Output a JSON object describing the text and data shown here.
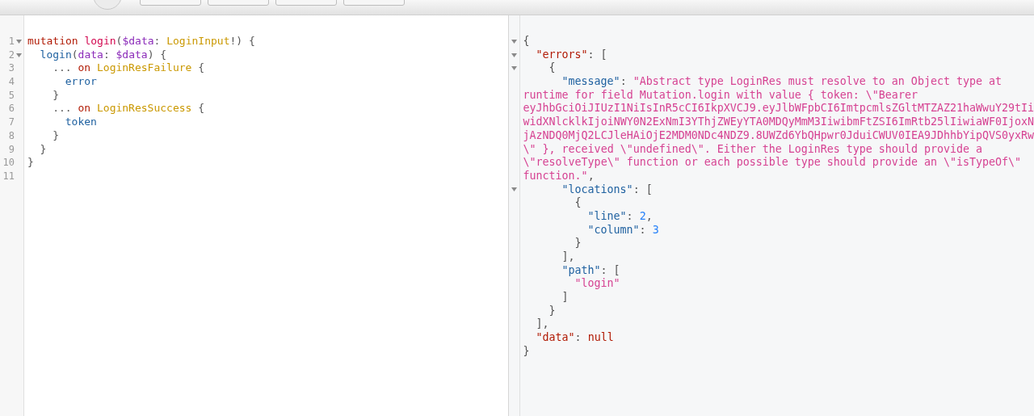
{
  "toolbar": {
    "buttons": [
      {
        "kind": "round"
      },
      {
        "kind": "rect"
      },
      {
        "kind": "rect"
      },
      {
        "kind": "rect"
      },
      {
        "kind": "rect"
      }
    ]
  },
  "editor": {
    "lines": [
      {
        "number": "1",
        "fold": true,
        "tokens": [
          {
            "kind": "keyword",
            "text": "mutation "
          },
          {
            "kind": "def",
            "text": "login"
          },
          {
            "kind": "punct",
            "text": "("
          },
          {
            "kind": "variable",
            "text": "$data"
          },
          {
            "kind": "punct",
            "text": ": "
          },
          {
            "kind": "type",
            "text": "LoginInput"
          },
          {
            "kind": "punct",
            "text": "!) {"
          }
        ]
      },
      {
        "number": "2",
        "fold": true,
        "tokens": [
          {
            "kind": "property",
            "text": "login"
          },
          {
            "kind": "punct",
            "text": "("
          },
          {
            "kind": "attribute",
            "text": "data"
          },
          {
            "kind": "punct",
            "text": ": "
          },
          {
            "kind": "variable",
            "text": "$data"
          },
          {
            "kind": "punct",
            "text": ") {"
          }
        ]
      },
      {
        "number": "3",
        "fold": false,
        "tokens": [
          {
            "kind": "punct",
            "text": "... "
          },
          {
            "kind": "keyword",
            "text": "on "
          },
          {
            "kind": "type",
            "text": "LoginResFailure"
          },
          {
            "kind": "punct",
            "text": " {"
          }
        ]
      },
      {
        "number": "4",
        "fold": false,
        "tokens": [
          {
            "kind": "property",
            "text": "error"
          }
        ]
      },
      {
        "number": "5",
        "fold": false,
        "tokens": [
          {
            "kind": "punct",
            "text": "}"
          }
        ]
      },
      {
        "number": "6",
        "fold": false,
        "tokens": [
          {
            "kind": "punct",
            "text": "... "
          },
          {
            "kind": "keyword",
            "text": "on "
          },
          {
            "kind": "type",
            "text": "LoginResSuccess"
          },
          {
            "kind": "punct",
            "text": " {"
          }
        ]
      },
      {
        "number": "7",
        "fold": false,
        "tokens": [
          {
            "kind": "property",
            "text": "token"
          }
        ]
      },
      {
        "number": "8",
        "fold": false,
        "tokens": [
          {
            "kind": "punct",
            "text": "}"
          }
        ]
      },
      {
        "number": "9",
        "fold": false,
        "tokens": [
          {
            "kind": "punct",
            "text": "}"
          }
        ]
      },
      {
        "number": "10",
        "fold": false,
        "tokens": [
          {
            "kind": "punct",
            "text": "}"
          }
        ]
      },
      {
        "number": "11",
        "fold": false
      }
    ]
  },
  "result": {
    "lines": [
      {
        "fold": true,
        "kind": "code",
        "tokens": [
          {
            "kind": "punct",
            "text": "{"
          }
        ]
      },
      {
        "fold": true,
        "kind": "code",
        "tokens": [
          {
            "kind": "keyred",
            "text": "\"errors\""
          },
          {
            "kind": "punct",
            "text": ": ["
          }
        ]
      },
      {
        "fold": true,
        "kind": "code",
        "tokens": [
          {
            "kind": "punct",
            "text": "{"
          }
        ]
      },
      {
        "fold": false,
        "kind": "code",
        "tokens": [
          {
            "kind": "key",
            "text": "\"message\""
          },
          {
            "kind": "punct",
            "text": ": "
          },
          {
            "kind": "string",
            "text": "\"Abstract type LoginRes must resolve to an Object type at"
          }
        ]
      },
      {
        "fold": false,
        "kind": "wrap",
        "tokens": [
          {
            "kind": "string",
            "text": "runtime for field Mutation.login with value { token: \\\"Bearer"
          }
        ]
      },
      {
        "fold": false,
        "kind": "wrap",
        "tokens": [
          {
            "kind": "string",
            "text": "eyJhbGciOiJIUzI1NiIsInR5cCI6IkpXVCJ9.eyJlbWFpbCI6ImtpcmlsZGltMTZAZ21haWwuY29tIi"
          }
        ]
      },
      {
        "fold": false,
        "kind": "wrap",
        "tokens": [
          {
            "kind": "string",
            "text": "widXNlcklkIjoiNWY0N2ExNmI3YThjZWEyYTA0MDQyMmM3IiwibmFtZSI6ImRtb25lIiwiaWF0IjoxN"
          }
        ]
      },
      {
        "fold": false,
        "kind": "wrap",
        "tokens": [
          {
            "kind": "string",
            "text": "jAzNDQ0MjQ2LCJleHAiOjE2MDM0NDc4NDZ9.8UWZd6YbQHpwr0JduiCWUV0IEA9JDhhbYipQVS0yxRw"
          }
        ]
      },
      {
        "fold": false,
        "kind": "wrap",
        "tokens": [
          {
            "kind": "string",
            "text": "\\\" }, received \\\"undefined\\\". Either the LoginRes type should provide a"
          }
        ]
      },
      {
        "fold": false,
        "kind": "wrap",
        "tokens": [
          {
            "kind": "string",
            "text": "\\\"resolveType\\\" function or each possible type should provide an \\\"isTypeOf\\\""
          }
        ]
      },
      {
        "fold": false,
        "kind": "wrap",
        "tokens": [
          {
            "kind": "string",
            "text": "function.\""
          },
          {
            "kind": "punct",
            "text": ","
          }
        ]
      },
      {
        "fold": true,
        "kind": "code",
        "tokens": [
          {
            "kind": "key",
            "text": "\"locations\""
          },
          {
            "kind": "punct",
            "text": ": ["
          }
        ]
      },
      {
        "fold": false,
        "kind": "code",
        "tokens": [
          {
            "kind": "punct",
            "text": "{"
          }
        ]
      },
      {
        "fold": false,
        "kind": "code",
        "tokens": [
          {
            "kind": "key",
            "text": "\"line\""
          },
          {
            "kind": "punct",
            "text": ": "
          },
          {
            "kind": "number",
            "text": "2"
          },
          {
            "kind": "punct",
            "text": ","
          }
        ]
      },
      {
        "fold": false,
        "kind": "code",
        "tokens": [
          {
            "kind": "key",
            "text": "\"column\""
          },
          {
            "kind": "punct",
            "text": ": "
          },
          {
            "kind": "number",
            "text": "3"
          }
        ]
      },
      {
        "fold": false,
        "kind": "code",
        "tokens": [
          {
            "kind": "punct",
            "text": "}"
          }
        ]
      },
      {
        "fold": false,
        "kind": "code",
        "tokens": [
          {
            "kind": "punct",
            "text": "],"
          }
        ]
      },
      {
        "fold": false,
        "kind": "code",
        "tokens": [
          {
            "kind": "key",
            "text": "\"path\""
          },
          {
            "kind": "punct",
            "text": ": ["
          }
        ]
      },
      {
        "fold": false,
        "kind": "code",
        "tokens": [
          {
            "kind": "string",
            "text": "\"login\""
          }
        ]
      },
      {
        "fold": false,
        "kind": "code",
        "tokens": [
          {
            "kind": "punct",
            "text": "]"
          }
        ]
      },
      {
        "fold": false,
        "kind": "code",
        "tokens": [
          {
            "kind": "punct",
            "text": "}"
          }
        ]
      },
      {
        "fold": false,
        "kind": "code",
        "tokens": [
          {
            "kind": "punct",
            "text": "],"
          }
        ]
      },
      {
        "fold": false,
        "kind": "code",
        "tokens": [
          {
            "kind": "keyred",
            "text": "\"data\""
          },
          {
            "kind": "punct",
            "text": ": "
          },
          {
            "kind": "nullv",
            "text": "null"
          }
        ]
      },
      {
        "fold": false,
        "kind": "code",
        "tokens": [
          {
            "kind": "punct",
            "text": "}"
          }
        ]
      }
    ]
  }
}
